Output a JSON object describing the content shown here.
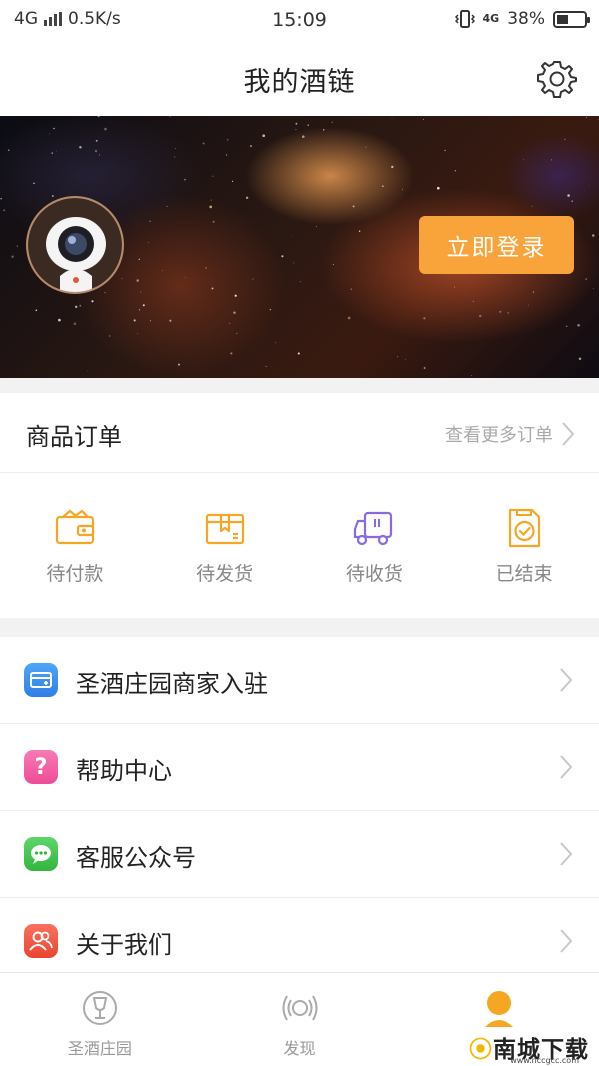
{
  "status_bar": {
    "network": "4G",
    "speed": "0.5K/s",
    "time": "15:09",
    "mobile_badge": "4G",
    "battery": "38%",
    "battery_level": 0.38
  },
  "header": {
    "title": "我的酒链",
    "settings_icon": "gear-icon"
  },
  "profile": {
    "login_label": "立即登录",
    "avatar_icon": "robot-camera-avatar"
  },
  "orders": {
    "title": "商品订单",
    "more_label": "查看更多订单",
    "items": [
      {
        "label": "待付款",
        "icon": "wallet-icon",
        "color": "#f5a623"
      },
      {
        "label": "待发货",
        "icon": "package-icon",
        "color": "#f5a623"
      },
      {
        "label": "待收货",
        "icon": "truck-icon",
        "color": "#8a6ae0"
      },
      {
        "label": "已结束",
        "icon": "check-document-icon",
        "color": "#f5a623"
      }
    ]
  },
  "menu": {
    "items": [
      {
        "label": "圣酒庄园商家入驻",
        "icon": "store-icon",
        "color": "#3b8cf0"
      },
      {
        "label": "帮助中心",
        "icon": "question-icon",
        "color": "#f25aa0"
      },
      {
        "label": "客服公众号",
        "icon": "chat-icon",
        "color": "#3fc24a"
      },
      {
        "label": "关于我们",
        "icon": "people-icon",
        "color": "#f2553f"
      }
    ]
  },
  "tabbar": {
    "items": [
      {
        "label": "圣酒庄园",
        "icon": "wine-glass-icon"
      },
      {
        "label": "发现",
        "icon": "discover-icon"
      },
      {
        "label": "",
        "icon": "user-icon",
        "active_color": "#f5a623"
      }
    ]
  },
  "watermark": {
    "text": "南城下载",
    "url": "www.nccgcc.com"
  }
}
